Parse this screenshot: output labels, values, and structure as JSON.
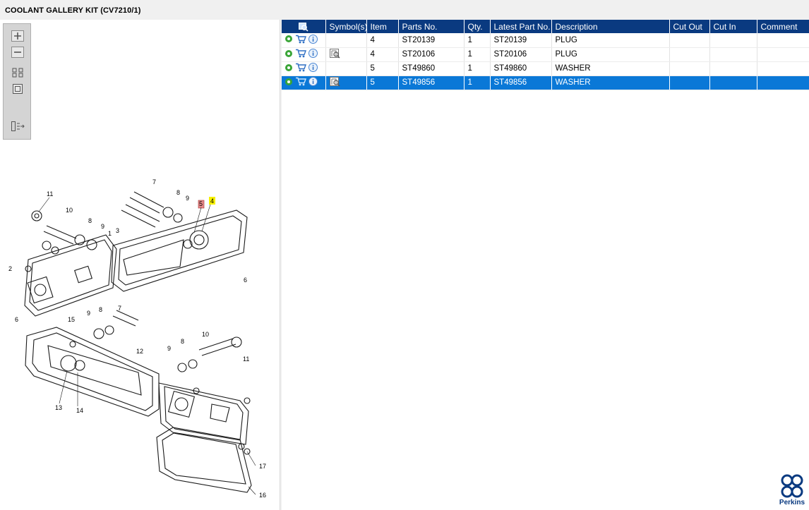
{
  "window": {
    "title": "COOLANT GALLERY KIT (CV7210/1)"
  },
  "toolbox": {
    "tools": [
      {
        "name": "zoom-in-icon"
      },
      {
        "name": "zoom-out-icon"
      },
      {
        "name": "fit-all-icon"
      },
      {
        "name": "fit-page-icon"
      },
      {
        "name": "toggle-list-icon"
      }
    ]
  },
  "diagram": {
    "callouts": [
      "11",
      "10",
      "8",
      "9",
      "7",
      "8",
      "9",
      "5",
      "4",
      "1",
      "3",
      "2",
      "6",
      "6",
      "15",
      "9",
      "8",
      "7",
      "12",
      "10",
      "11",
      "9",
      "8",
      "13",
      "14",
      "17",
      "16"
    ],
    "highlighted_callout": "4",
    "flagged_callout": "5"
  },
  "parts_table": {
    "headers": [
      "",
      "Symbol(s)",
      "Item",
      "Parts No.",
      "Qty.",
      "Latest Part No.",
      "Description",
      "Cut Out",
      "Cut In",
      "Comment"
    ],
    "rows": [
      {
        "symbol": false,
        "item": "4",
        "parts_no": "ST20139",
        "qty": "1",
        "latest": "ST20139",
        "description": "PLUG",
        "cut_out": "",
        "cut_in": "",
        "comment": ""
      },
      {
        "symbol": true,
        "item": "4",
        "parts_no": "ST20106",
        "qty": "1",
        "latest": "ST20106",
        "description": "PLUG",
        "cut_out": "",
        "cut_in": "",
        "comment": ""
      },
      {
        "symbol": false,
        "item": "5",
        "parts_no": "ST49860",
        "qty": "1",
        "latest": "ST49860",
        "description": "WASHER",
        "cut_out": "",
        "cut_in": "",
        "comment": ""
      },
      {
        "symbol": true,
        "item": "5",
        "parts_no": "ST49856",
        "qty": "1",
        "latest": "ST49856",
        "description": "WASHER",
        "cut_out": "",
        "cut_in": "",
        "comment": ""
      }
    ],
    "selected_row": 3
  },
  "colors": {
    "header_bg": "#0a3a80",
    "selection_bg": "#0a78d7",
    "brand": "#0a3a80"
  },
  "brand": {
    "name": "Perkins"
  }
}
